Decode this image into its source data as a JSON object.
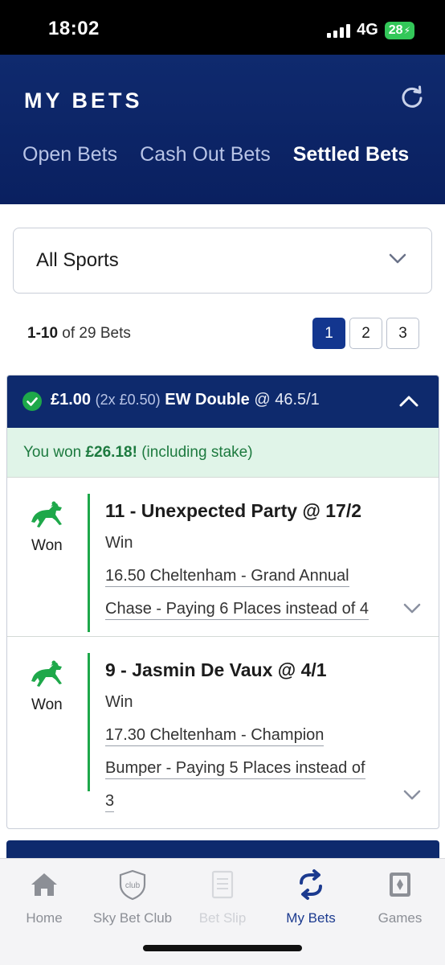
{
  "status_bar": {
    "time": "18:02",
    "network": "4G",
    "battery": "28"
  },
  "header": {
    "title": "MY BETS",
    "tabs": [
      {
        "label": "Open Bets",
        "active": false
      },
      {
        "label": "Cash Out Bets",
        "active": false
      },
      {
        "label": "Settled Bets",
        "active": true
      }
    ]
  },
  "filter": {
    "selected": "All Sports"
  },
  "pagination": {
    "range": "1-10",
    "suffix": " of 29 Bets",
    "pages": [
      "1",
      "2",
      "3"
    ],
    "active_page": "1"
  },
  "bet": {
    "stake": "£1.00",
    "split": "(2x £0.50)",
    "type": "EW Double",
    "odds": "@ 46.5/1",
    "won_prefix": "You won ",
    "won_amount": "£26.18!",
    "won_suffix": " (including stake)",
    "legs": [
      {
        "status": "Won",
        "title": "11 - Unexpected Party @ 17/2",
        "market": "Win",
        "event_lines": [
          "16.50 Cheltenham - Grand Annual",
          "Chase - Paying 6 Places instead of 4"
        ]
      },
      {
        "status": "Won",
        "title": "9 - Jasmin De Vaux @ 4/1",
        "market": "Win",
        "event_lines": [
          "17.30 Cheltenham - Champion",
          "Bumper - Paying 5 Places instead of",
          "3"
        ]
      }
    ]
  },
  "bottom_nav": [
    {
      "label": "Home",
      "icon": "home-icon",
      "state": "normal"
    },
    {
      "label": "Sky Bet Club",
      "icon": "club-shield-icon",
      "state": "normal"
    },
    {
      "label": "Bet Slip",
      "icon": "bet-slip-icon",
      "state": "disabled"
    },
    {
      "label": "My Bets",
      "icon": "my-bets-icon",
      "state": "active"
    },
    {
      "label": "Games",
      "icon": "games-icon",
      "state": "normal"
    }
  ],
  "colors": {
    "brand_navy": "#0e2a6d",
    "win_green": "#1ea84a",
    "active_page": "#13368f"
  }
}
